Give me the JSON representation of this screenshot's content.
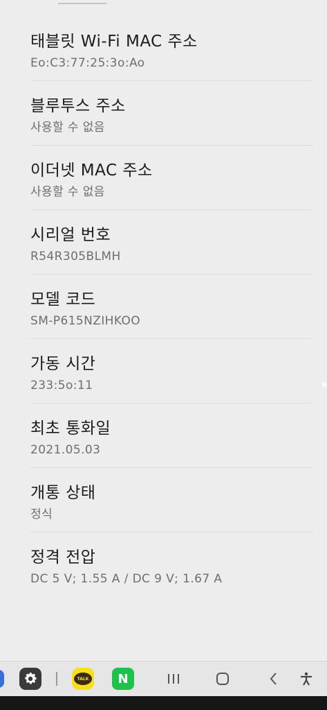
{
  "items": [
    {
      "title": "태블릿 Wi-Fi MAC 주소",
      "value": "Eo:C3:77:25:3o:Ao"
    },
    {
      "title": "블루투스 주소",
      "value": "사용할 수 없음"
    },
    {
      "title": "이더넷 MAC 주소",
      "value": "사용할 수 없음"
    },
    {
      "title": "시리얼 번호",
      "value": "R54R305BLMH"
    },
    {
      "title": "모델 코드",
      "value": "SM-P615NZIHKOO"
    },
    {
      "title": "가동 시간",
      "value": "233:5o:11"
    },
    {
      "title": "최초 통화일",
      "value": "2021.05.03"
    },
    {
      "title": "개통 상태",
      "value": "정식"
    },
    {
      "title": "정격 전압",
      "value": "DC 5 V; 1.55 A / DC 9 V; 1.67 A"
    }
  ],
  "navbar": {
    "talk_label": "TALK",
    "naver_label": "N",
    "icons": [
      "settings-gear-icon",
      "kakaotalk-icon",
      "naver-icon",
      "recents-icon",
      "home-icon",
      "back-icon",
      "accessibility-icon"
    ]
  },
  "colors": {
    "background": "#ededed",
    "title": "#1c1c1c",
    "value": "#6e6e6e",
    "kakao": "#f7e01a",
    "naver": "#1ec14a"
  }
}
